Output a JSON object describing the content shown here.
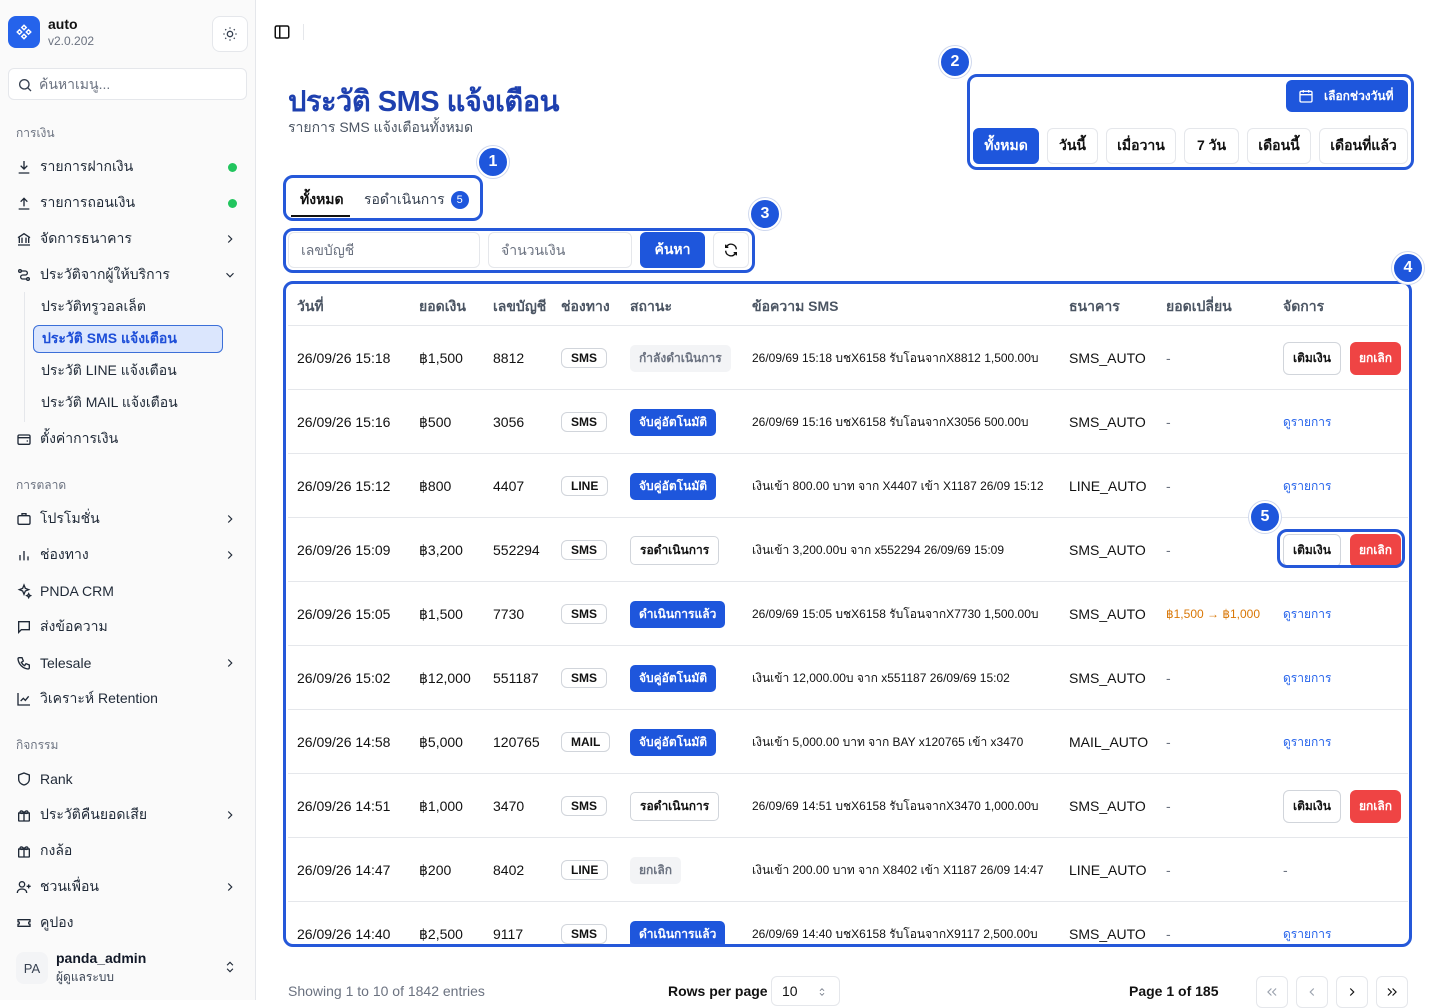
{
  "app": {
    "name": "auto",
    "version": "v2.0.202"
  },
  "sidebar": {
    "search_placeholder": "ค้นหาเมนู...",
    "sections": {
      "finance": "การเงิน",
      "marketing": "การตลาด",
      "activity": "กิจกรรม"
    },
    "items": {
      "deposit": "รายการฝากเงิน",
      "withdraw": "รายการถอนเงิน",
      "bank": "จัดการธนาคาร",
      "provider_history": "ประวัติจากผู้ให้บริการ",
      "sub_slip": "ประวัติทรูวอลเล็ต",
      "sub_sms": "ประวัติ SMS แจ้งเตือน",
      "sub_line": "ประวัติ LINE แจ้งเตือน",
      "sub_mail": "ประวัติ MAIL แจ้งเตือน",
      "finance_settings": "ตั้งค่าการเงิน",
      "promotion": "โปรโมชั่น",
      "channel": "ช่องทาง",
      "crm": "PNDA CRM",
      "send_message": "ส่งข้อความ",
      "telesale": "Telesale",
      "retention": "วิเคราะห์ Retention",
      "rank": "Rank",
      "cashback": "ประวัติคืนยอดเสีย",
      "mystery_box": "กงล้อ",
      "referral": "ชวนเพื่อน",
      "coupon": "คูปอง"
    },
    "user": {
      "initials": "PA",
      "name": "panda_admin",
      "role": "ผู้ดูแลระบบ"
    }
  },
  "page": {
    "title": "ประวัติ SMS แจ้งเตือน",
    "subtitle": "รายการ SMS แจ้งเตือนทั้งหมด"
  },
  "tabs": {
    "all": "ทั้งหมด",
    "pending": "รอดำเนินการ",
    "pending_count": "5"
  },
  "filters": {
    "account_placeholder": "เลขบัญชี",
    "amount_placeholder": "จำนวนเงิน",
    "search_label": "ค้นหา"
  },
  "date_range": {
    "picker_label": "เลือกช่วงวันที่",
    "options": [
      "ทั้งหมด",
      "วันนี้",
      "เมื่อวาน",
      "7 วัน",
      "เดือนนี้",
      "เดือนที่แล้ว"
    ]
  },
  "annotations": [
    "1",
    "2",
    "3",
    "4",
    "5"
  ],
  "table": {
    "headers": [
      "วันที่",
      "ยอดเงิน",
      "เลขบัญชี",
      "ช่องทาง",
      "สถานะ",
      "ข้อความ SMS",
      "ธนาคาร",
      "ยอดเปลี่ยน",
      "จัดการ"
    ],
    "action_labels": {
      "topup": "เติมเงิน",
      "cancel": "ยกเลิก",
      "view": "ดูรายการ"
    },
    "rows": [
      {
        "date": "26/09/26 15:18",
        "amount": "฿1,500",
        "account": "8812",
        "channel": "SMS",
        "status": "กำลังดำเนินการ",
        "status_type": "proc",
        "message": "26/09/69 15:18 บชX6158 รับโอนจากX8812 1,500.00บ",
        "bank": "SMS_AUTO",
        "change": "-",
        "action": "buttons"
      },
      {
        "date": "26/09/26 15:16",
        "amount": "฿500",
        "account": "3056",
        "channel": "SMS",
        "status": "จับคู่อัตโนมัติ",
        "status_type": "auto",
        "message": "26/09/69 15:16 บชX6158 รับโอนจากX3056 500.00บ",
        "bank": "SMS_AUTO",
        "change": "-",
        "action": "view"
      },
      {
        "date": "26/09/26 15:12",
        "amount": "฿800",
        "account": "4407",
        "channel": "LINE",
        "status": "จับคู่อัตโนมัติ",
        "status_type": "auto",
        "message": "เงินเข้า 800.00 บาท จาก X4407 เข้า X1187 26/09 15:12",
        "bank": "LINE_AUTO",
        "change": "-",
        "action": "view"
      },
      {
        "date": "26/09/26 15:09",
        "amount": "฿3,200",
        "account": "552294",
        "channel": "SMS",
        "status": "รอดำเนินการ",
        "status_type": "wait",
        "message": "เงินเข้า 3,200.00บ จาก x552294 26/09/69 15:09",
        "bank": "SMS_AUTO",
        "change": "-",
        "action": "buttons"
      },
      {
        "date": "26/09/26 15:05",
        "amount": "฿1,500",
        "account": "7730",
        "channel": "SMS",
        "status": "ดำเนินการแล้ว",
        "status_type": "done",
        "message": "26/09/69 15:05 บชX6158 รับโอนจากX7730 1,500.00บ",
        "bank": "SMS_AUTO",
        "change": "฿1,500 → ฿1,000",
        "action": "view"
      },
      {
        "date": "26/09/26 15:02",
        "amount": "฿12,000",
        "account": "551187",
        "channel": "SMS",
        "status": "จับคู่อัตโนมัติ",
        "status_type": "auto",
        "message": "เงินเข้า 12,000.00บ จาก x551187 26/09/69 15:02",
        "bank": "SMS_AUTO",
        "change": "-",
        "action": "view"
      },
      {
        "date": "26/09/26 14:58",
        "amount": "฿5,000",
        "account": "120765",
        "channel": "MAIL",
        "status": "จับคู่อัตโนมัติ",
        "status_type": "auto",
        "message": "เงินเข้า 5,000.00 บาท จาก BAY x120765 เข้า x3470",
        "bank": "MAIL_AUTO",
        "change": "-",
        "action": "view"
      },
      {
        "date": "26/09/26 14:51",
        "amount": "฿1,000",
        "account": "3470",
        "channel": "SMS",
        "status": "รอดำเนินการ",
        "status_type": "wait",
        "message": "26/09/69 14:51 บชX6158 รับโอนจากX3470 1,000.00บ",
        "bank": "SMS_AUTO",
        "change": "-",
        "action": "buttons"
      },
      {
        "date": "26/09/26 14:47",
        "amount": "฿200",
        "account": "8402",
        "channel": "LINE",
        "status": "ยกเลิก",
        "status_type": "cancel",
        "message": "เงินเข้า 200.00 บาท จาก X8402 เข้า X1187 26/09 14:47",
        "bank": "LINE_AUTO",
        "change": "-",
        "action": "dash"
      },
      {
        "date": "26/09/26 14:40",
        "amount": "฿2,500",
        "account": "9117",
        "channel": "SMS",
        "status": "ดำเนินการแล้ว",
        "status_type": "done",
        "message": "26/09/69 14:40 บชX6158 รับโอนจากX9117 2,500.00บ",
        "bank": "SMS_AUTO",
        "change": "-",
        "action": "view"
      }
    ]
  },
  "footer": {
    "showing": "Showing 1 to 10 of 1842 entries",
    "rows_per_page_label": "Rows per page",
    "rows_per_page": "10",
    "page_label": "Page 1 of 185"
  }
}
